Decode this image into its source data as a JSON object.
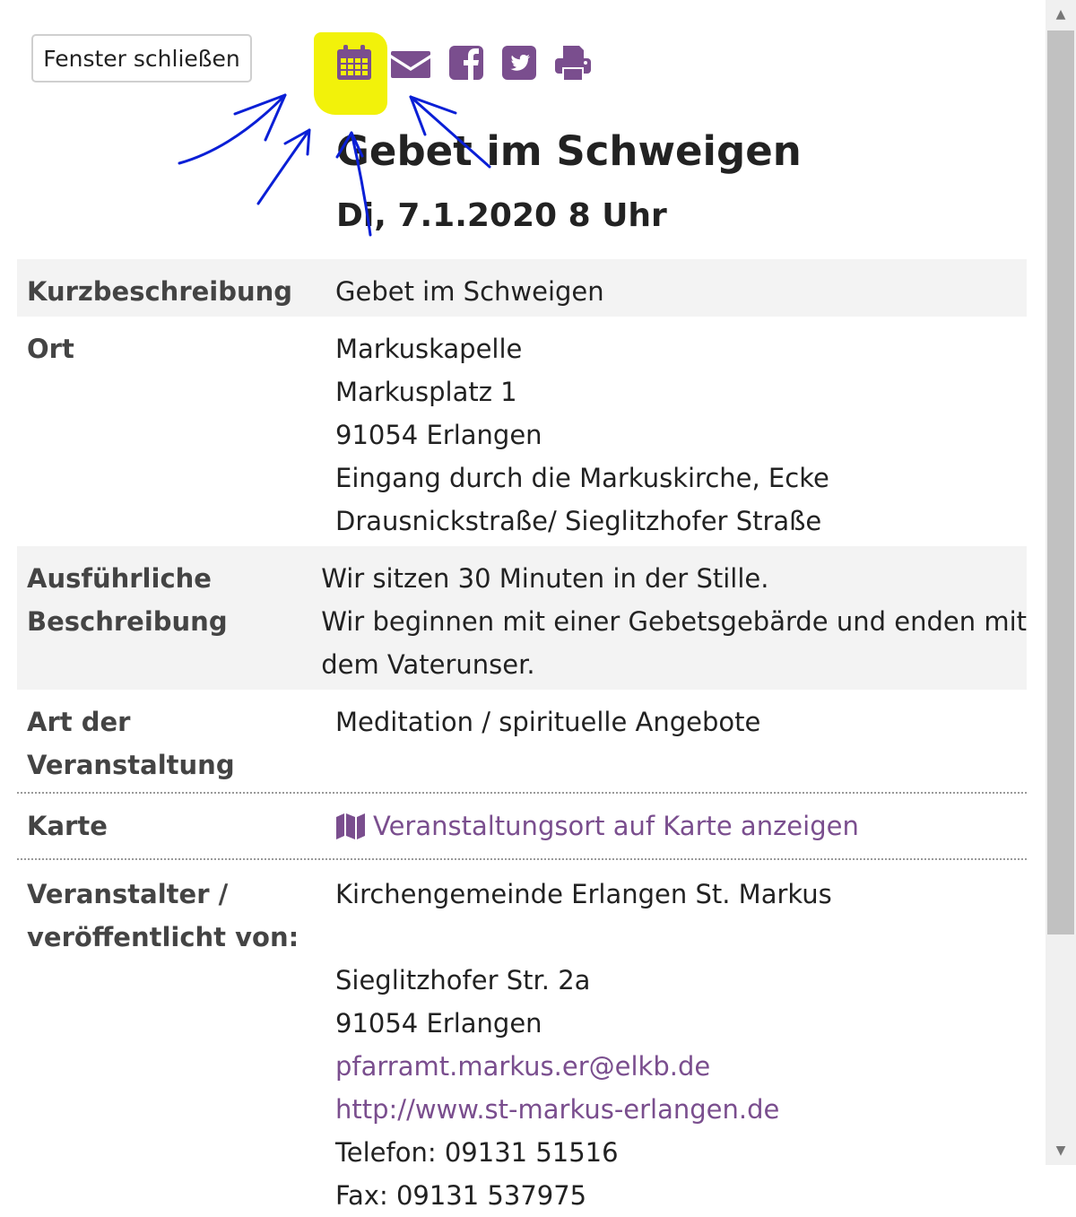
{
  "header": {
    "close_button_label": "Fenster schließen",
    "icons": [
      "calendar-icon",
      "envelope-icon",
      "facebook-icon",
      "twitter-icon",
      "print-icon"
    ],
    "icon_color": "#7a4e8e",
    "highlight_color": "#f2f20a",
    "annotation_color": "#0a1fd6"
  },
  "event": {
    "title": "Gebet im Schweigen",
    "date": "Di, 7.1.2020 8 Uhr"
  },
  "details": {
    "kurzbeschreibung": {
      "label": "Kurzbeschreibung",
      "value": "Gebet im Schweigen"
    },
    "ort": {
      "label": "Ort",
      "lines": [
        "Markuskapelle",
        "Markusplatz 1",
        "91054 Erlangen",
        "Eingang durch die Markuskirche, Ecke",
        "Drausnickstraße/ Sieglitzhofer Straße"
      ]
    },
    "beschreibung": {
      "label_line1": "Ausführliche",
      "label_line2": "Beschreibung",
      "lines": [
        "Wir sitzen 30 Minuten in der Stille.",
        "Wir beginnen mit einer Gebetsgebärde und enden mit",
        "dem Vaterunser."
      ]
    },
    "art": {
      "label": "Art der Veranstaltung",
      "value": "Meditation / spirituelle Angebote"
    },
    "karte": {
      "label": "Karte",
      "link_text": "Veranstaltungsort auf Karte anzeigen"
    },
    "veranstalter": {
      "label_line1": "Veranstalter /",
      "label_line2": "veröffentlicht von:",
      "name": "Kirchengemeinde Erlangen St. Markus",
      "street": "Sieglitzhofer Str. 2a",
      "city": "91054 Erlangen",
      "email": "pfarramt.markus.er@elkb.de",
      "website": "http://www.st-markus-erlangen.de",
      "phone": "Telefon: 09131 51516",
      "fax": "Fax: 09131 537975"
    }
  }
}
